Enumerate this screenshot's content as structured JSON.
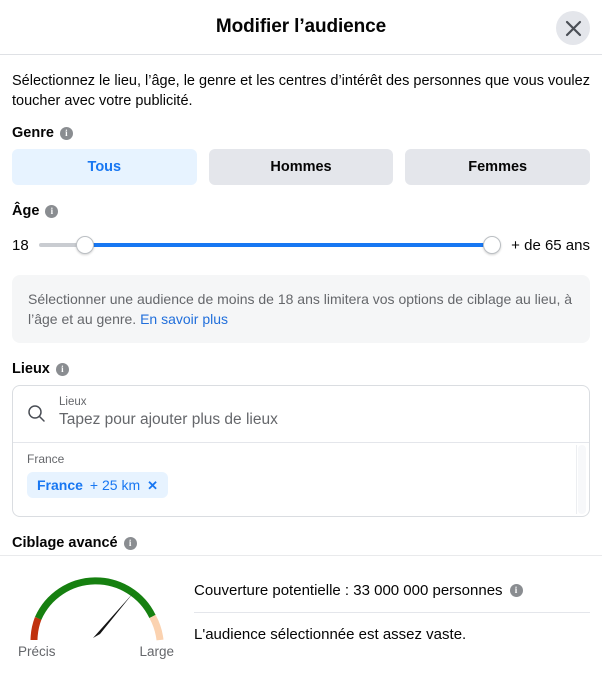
{
  "header": {
    "title": "Modifier l’audience",
    "close_label": "close-icon"
  },
  "intro": "Sélectionnez le lieu, l’âge, le genre et les centres d’intérêt des personnes que vous voulez toucher avec votre publicité.",
  "gender": {
    "label": "Genre",
    "options": [
      {
        "label": "Tous",
        "selected": true
      },
      {
        "label": "Hommes",
        "selected": false
      },
      {
        "label": "Femmes",
        "selected": false
      }
    ]
  },
  "age": {
    "label": "Âge",
    "min_value": "18",
    "max_value": "+ de 65 ans",
    "min_percent": 10,
    "max_percent": 98,
    "notice_text": "Sélectionner une audience de moins de 18 ans limitera vos options de ciblage au lieu, à l’âge et au genre.",
    "notice_link": "En savoir plus"
  },
  "locations": {
    "label": "Lieux",
    "field_mini_label": "Lieux",
    "placeholder": "Tapez pour ajouter plus de lieux",
    "group_label": "France",
    "chips": [
      {
        "name": "France",
        "radius": "+ 25 km",
        "remove": "✕"
      }
    ]
  },
  "advanced": {
    "label": "Ciblage avancé"
  },
  "footer": {
    "gauge": {
      "left_label": "Précis",
      "right_label": "Large",
      "needle_angle_deg": 52,
      "colors": {
        "low": "#c0310d",
        "mid": "#168010",
        "high": "#fbd2b0"
      }
    },
    "reach_text": "Couverture potentielle : 33 000 000 personnes",
    "reach_sub": "L'audience sélectionnée est assez vaste."
  },
  "colors": {
    "accent": "#1877f2",
    "accent_soft": "#e7f3ff",
    "neutral_btn": "#e4e6eb",
    "text": "#050505",
    "text_secondary": "#65676b"
  }
}
